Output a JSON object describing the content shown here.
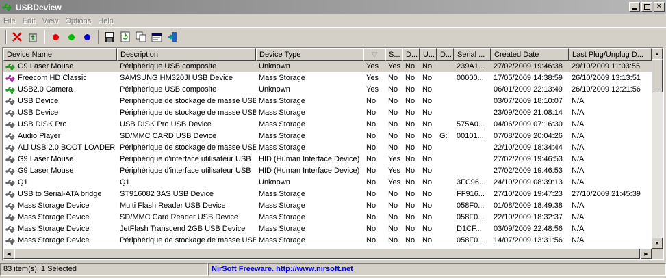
{
  "window": {
    "title": "USBDeview"
  },
  "menu": [
    "File",
    "Edit",
    "View",
    "Options",
    "Help"
  ],
  "toolbar": {
    "items": [
      {
        "name": "uninstall-icon"
      },
      {
        "name": "recycle-icon"
      },
      {
        "name": "red-dot-icon",
        "color": "#e00000"
      },
      {
        "name": "green-dot-icon",
        "color": "#00c000"
      },
      {
        "name": "blue-dot-icon",
        "color": "#0000d0"
      },
      {
        "name": "save-icon"
      },
      {
        "name": "refresh-icon"
      },
      {
        "name": "copy-icon"
      },
      {
        "name": "properties-icon"
      },
      {
        "name": "exit-icon"
      }
    ]
  },
  "columns": [
    {
      "label": "Device Name",
      "w": 166
    },
    {
      "label": "Description",
      "w": 203
    },
    {
      "label": "Device Type",
      "w": 157
    },
    {
      "label": "",
      "w": 32,
      "sort": true
    },
    {
      "label": "S...",
      "w": 25
    },
    {
      "label": "D...",
      "w": 25
    },
    {
      "label": "U...",
      "w": 25
    },
    {
      "label": "D...",
      "w": 25
    },
    {
      "label": "Serial ...",
      "w": 54
    },
    {
      "label": "Created Date",
      "w": 114
    },
    {
      "label": "Last Plug/Unplug D...",
      "w": 121
    }
  ],
  "rows": [
    {
      "name": "G9 Laser Mouse",
      "desc": "Périphérique USB composite",
      "type": "Unknown",
      "c1": "Yes",
      "c2": "Yes",
      "c3": "No",
      "c4": "No",
      "c5": "",
      "serial": "239A1...",
      "created": "27/02/2009 19:46:38",
      "last": "29/10/2009 11:03:55",
      "selected": true,
      "icon": "green"
    },
    {
      "name": "Freecom HD Classic",
      "desc": "SAMSUNG HM320JI USB Device",
      "type": "Mass Storage",
      "c1": "Yes",
      "c2": "No",
      "c3": "No",
      "c4": "No",
      "c5": "",
      "serial": "00000...",
      "created": "17/05/2009 14:38:59",
      "last": "26/10/2009 13:13:51",
      "icon": "magenta"
    },
    {
      "name": "USB2.0 Camera",
      "desc": "Périphérique USB composite",
      "type": "Unknown",
      "c1": "Yes",
      "c2": "No",
      "c3": "No",
      "c4": "No",
      "c5": "",
      "serial": "",
      "created": "06/01/2009 22:13:49",
      "last": "26/10/2009 12:21:56",
      "icon": "green"
    },
    {
      "name": "USB Device",
      "desc": "Périphérique de stockage de masse USB",
      "type": "Mass Storage",
      "c1": "No",
      "c2": "No",
      "c3": "No",
      "c4": "No",
      "c5": "",
      "serial": "",
      "created": "03/07/2009 18:10:07",
      "last": "N/A",
      "icon": "gray"
    },
    {
      "name": "USB Device",
      "desc": "Périphérique de stockage de masse USB",
      "type": "Mass Storage",
      "c1": "No",
      "c2": "No",
      "c3": "No",
      "c4": "No",
      "c5": "",
      "serial": "",
      "created": "23/09/2009 21:08:14",
      "last": "N/A",
      "icon": "gray"
    },
    {
      "name": "USB DISK Pro",
      "desc": "USB DISK Pro USB Device",
      "type": "Mass Storage",
      "c1": "No",
      "c2": "No",
      "c3": "No",
      "c4": "No",
      "c5": "",
      "serial": "575A0...",
      "created": "04/06/2009 07:16:30",
      "last": "N/A",
      "icon": "gray"
    },
    {
      "name": "Audio Player",
      "desc": "SD/MMC CARD USB Device",
      "type": "Mass Storage",
      "c1": "No",
      "c2": "No",
      "c3": "No",
      "c4": "No",
      "c5": "G:",
      "serial": "00101...",
      "created": "07/08/2009 20:04:26",
      "last": "N/A",
      "icon": "gray"
    },
    {
      "name": "ALi USB 2.0 BOOT LOADER",
      "desc": "Périphérique de stockage de masse USB",
      "type": "Mass Storage",
      "c1": "No",
      "c2": "No",
      "c3": "No",
      "c4": "No",
      "c5": "",
      "serial": "",
      "created": "22/10/2009 18:34:44",
      "last": "N/A",
      "icon": "gray"
    },
    {
      "name": "G9 Laser Mouse",
      "desc": "Périphérique d'interface utilisateur USB",
      "type": "HID (Human Interface Device)",
      "c1": "No",
      "c2": "Yes",
      "c3": "No",
      "c4": "No",
      "c5": "",
      "serial": "",
      "created": "27/02/2009 19:46:53",
      "last": "N/A",
      "icon": "gray"
    },
    {
      "name": "G9 Laser Mouse",
      "desc": "Périphérique d'interface utilisateur USB",
      "type": "HID (Human Interface Device)",
      "c1": "No",
      "c2": "Yes",
      "c3": "No",
      "c4": "No",
      "c5": "",
      "serial": "",
      "created": "27/02/2009 19:46:53",
      "last": "N/A",
      "icon": "gray"
    },
    {
      "name": "Q1",
      "desc": "Q1",
      "type": "Unknown",
      "c1": "No",
      "c2": "Yes",
      "c3": "No",
      "c4": "No",
      "c5": "",
      "serial": "3FC96...",
      "created": "24/10/2009 08:39:13",
      "last": "N/A",
      "icon": "gray"
    },
    {
      "name": "USB to Serial-ATA bridge",
      "desc": "ST916082 3AS USB Device",
      "type": "Mass Storage",
      "c1": "No",
      "c2": "No",
      "c3": "No",
      "c4": "No",
      "c5": "",
      "serial": "FF916...",
      "created": "27/10/2009 19:47:23",
      "last": "27/10/2009 21:45:39",
      "icon": "gray"
    },
    {
      "name": "Mass Storage Device",
      "desc": "Multi Flash Reader USB Device",
      "type": "Mass Storage",
      "c1": "No",
      "c2": "No",
      "c3": "No",
      "c4": "No",
      "c5": "",
      "serial": "058F0...",
      "created": "01/08/2009 18:49:38",
      "last": "N/A",
      "icon": "gray"
    },
    {
      "name": "Mass Storage Device",
      "desc": "SD/MMC Card  Reader USB Device",
      "type": "Mass Storage",
      "c1": "No",
      "c2": "No",
      "c3": "No",
      "c4": "No",
      "c5": "",
      "serial": "058F0...",
      "created": "22/10/2009 18:32:37",
      "last": "N/A",
      "icon": "gray"
    },
    {
      "name": "Mass Storage Device",
      "desc": "JetFlash Transcend 2GB USB Device",
      "type": "Mass Storage",
      "c1": "No",
      "c2": "No",
      "c3": "No",
      "c4": "No",
      "c5": "",
      "serial": "D1CF...",
      "created": "03/09/2009 22:48:56",
      "last": "N/A",
      "icon": "gray"
    },
    {
      "name": "Mass Storage Device",
      "desc": "Périphérique de stockage de masse USB",
      "type": "Mass Storage",
      "c1": "No",
      "c2": "No",
      "c3": "No",
      "c4": "No",
      "c5": "",
      "serial": "058F0...",
      "created": "14/07/2009 13:31:56",
      "last": "N/A",
      "icon": "gray"
    }
  ],
  "status": {
    "count": "83 item(s), 1 Selected",
    "credit": "NirSoft Freeware.  http://www.nirsoft.net"
  }
}
